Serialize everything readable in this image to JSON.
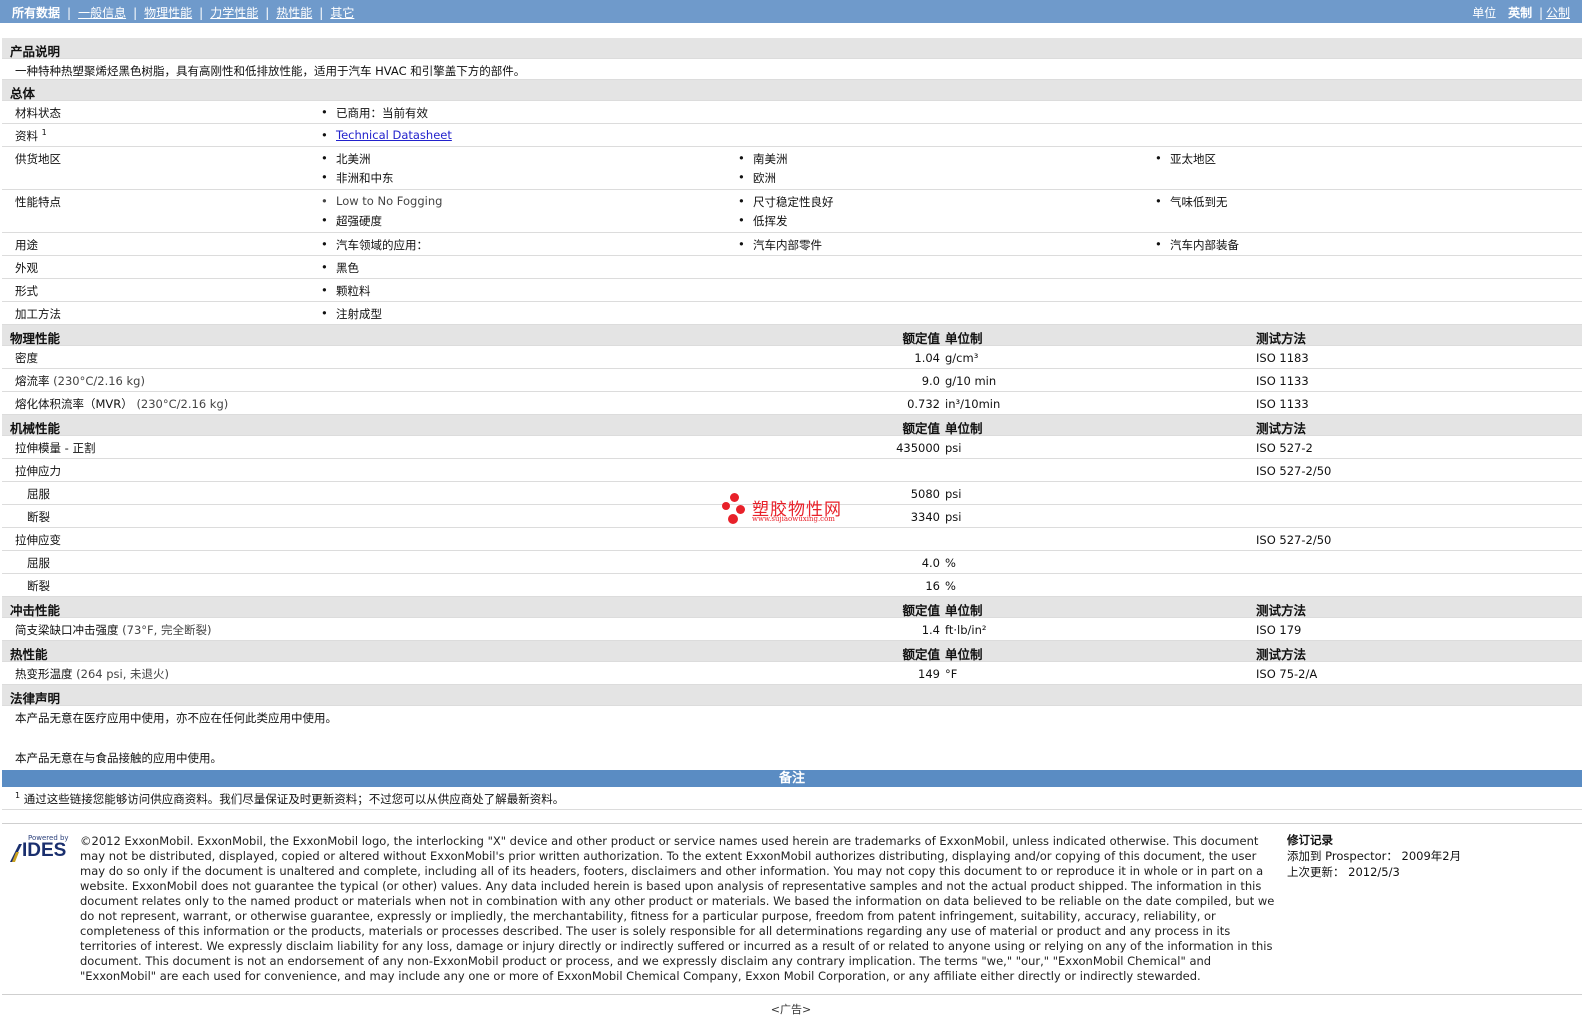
{
  "nav": {
    "items": [
      "所有数据",
      "一般信息",
      "物理性能",
      "力学性能",
      "热性能",
      "其它"
    ],
    "units_label": "单位",
    "units_options": [
      "英制",
      "公制"
    ]
  },
  "desc": {
    "title": "产品说明",
    "text": "一种特种热塑聚烯烃黑色树脂，具有高刚性和低排放性能，适用于汽车 HVAC 和引擎盖下方的部件。"
  },
  "general": {
    "title": "总体",
    "material_status": {
      "label": "材料状态",
      "value": "已商用：当前有效"
    },
    "documents": {
      "label": "资料",
      "sup": "1",
      "link": "Technical Datasheet"
    },
    "regions": {
      "label": "供货地区",
      "values": [
        "北美洲",
        "南美洲",
        "亚太地区",
        "非洲和中东",
        "欧洲"
      ]
    },
    "features": {
      "label": "性能特点",
      "values": [
        "Low to No Fogging",
        "尺寸稳定性良好",
        "气味低到无",
        "超强硬度",
        "低挥发"
      ]
    },
    "uses": {
      "label": "用途",
      "values": [
        "汽车领域的应用：",
        "汽车内部零件",
        "汽车内部装备"
      ]
    },
    "appearance": {
      "label": "外观",
      "value": "黑色"
    },
    "form": {
      "label": "形式",
      "value": "颗粒料"
    },
    "processing": {
      "label": "加工方法",
      "value": "注射成型"
    }
  },
  "col_headers": {
    "nominal": "额定值",
    "unit": "单位制",
    "method": "测试方法"
  },
  "physical": {
    "title": "物理性能",
    "rows": [
      {
        "label": "密度",
        "cond": "",
        "value": "1.04",
        "unit": "g/cm³",
        "method": "ISO 1183"
      },
      {
        "label": "熔流率",
        "cond": "(230°C/2.16 kg)",
        "value": "9.0",
        "unit": "g/10 min",
        "method": "ISO 1133"
      },
      {
        "label": "熔化体积流率（MVR）",
        "cond": "(230°C/2.16 kg)",
        "value": "0.732",
        "unit": "in³/10min",
        "method": "ISO 1133"
      }
    ]
  },
  "mechanical": {
    "title": "机械性能",
    "rows": [
      {
        "label": "拉伸模量 - 正割",
        "value": "435000",
        "unit": "psi",
        "method": "ISO 527-2"
      },
      {
        "label": "拉伸应力",
        "value": "",
        "unit": "",
        "method": "ISO 527-2/50"
      },
      {
        "label": "屈服",
        "value": "5080",
        "unit": "psi",
        "method": ""
      },
      {
        "label": "断裂",
        "value": "3340",
        "unit": "psi",
        "method": ""
      },
      {
        "label": "拉伸应变",
        "value": "",
        "unit": "",
        "method": "ISO 527-2/50"
      },
      {
        "label": "屈服",
        "value": "4.0",
        "unit": "%",
        "method": ""
      },
      {
        "label": "断裂",
        "value": "16",
        "unit": "%",
        "method": ""
      }
    ]
  },
  "impact": {
    "title": "冲击性能",
    "rows": [
      {
        "label": "简支梁缺口冲击强度",
        "cond": "(73°F, 完全断裂)",
        "value": "1.4",
        "unit": "ft·lb/in²",
        "method": "ISO 179"
      }
    ]
  },
  "thermal": {
    "title": "热性能",
    "rows": [
      {
        "label": "热变形温度",
        "cond": "(264 psi, 未退火)",
        "value": "149",
        "unit": "°F",
        "method": "ISO 75-2/A"
      }
    ]
  },
  "legal": {
    "title": "法律声明",
    "line1": "本产品无意在医疗应用中使用，亦不应在任何此类应用中使用。",
    "line2": "本产品无意在与食品接触的应用中使用。"
  },
  "notes": {
    "title": "备注",
    "footnote_num": "1",
    "footnote": "通过这些链接您能够访问供应商资料。我们尽量保证及时更新资料；不过您可以从供应商处了解最新资料。"
  },
  "footer": {
    "logo_powered": "Powered by",
    "logo_text": "IDES",
    "copyright": "©2012 ExxonMobil. ExxonMobil, the ExxonMobil logo, the interlocking \"X\" device and other product or service names used herein are trademarks of ExxonMobil, unless indicated otherwise. This document may not be distributed, displayed, copied or altered without ExxonMobil's prior written authorization. To the extent ExxonMobil authorizes distributing, displaying and/or copying of this document, the user may do so only if the document is unaltered and complete, including all of its headers, footers, disclaimers and other information. You may not copy this document to or reproduce it in whole or in part on a website. ExxonMobil does not guarantee the typical (or other) values. Any data included herein is based upon analysis of representative samples and not the actual product shipped. The information in this document relates only to the named product or materials when not in combination with any other product or materials. We based the information on data believed to be reliable on the date compiled, but we do not represent, warrant, or otherwise guarantee, expressly or impliedly, the merchantability, fitness for a particular purpose, freedom from patent infringement, suitability, accuracy, reliability, or completeness of this information or the products, materials or processes described. The user is solely responsible for all determinations regarding any use of material or product and any process in its territories of interest. We expressly disclaim liability for any loss, damage or injury directly or indirectly suffered or incurred as a result of or related to anyone using or relying on any of the information in this document. This document is not an endorsement of any non-ExxonMobil product or process, and we expressly disclaim any contrary implication. The terms \"we,\" \"our,\" \"ExxonMobil Chemical\" and \"ExxonMobil\" are each used for convenience, and may include any one or more of ExxonMobil Chemical Company, Exxon Mobil Corporation, or any affiliate either directly or indirectly stewarded.",
    "revision_title": "修订记录",
    "added_label": "添加到 Prospector：",
    "added_value": "2009年2月",
    "updated_label": "上次更新：",
    "updated_value": "2012/5/3"
  },
  "watermark": {
    "title": "塑胶物性网",
    "url": "www.sujiaowuxing.com"
  },
  "ad": "<广告>"
}
